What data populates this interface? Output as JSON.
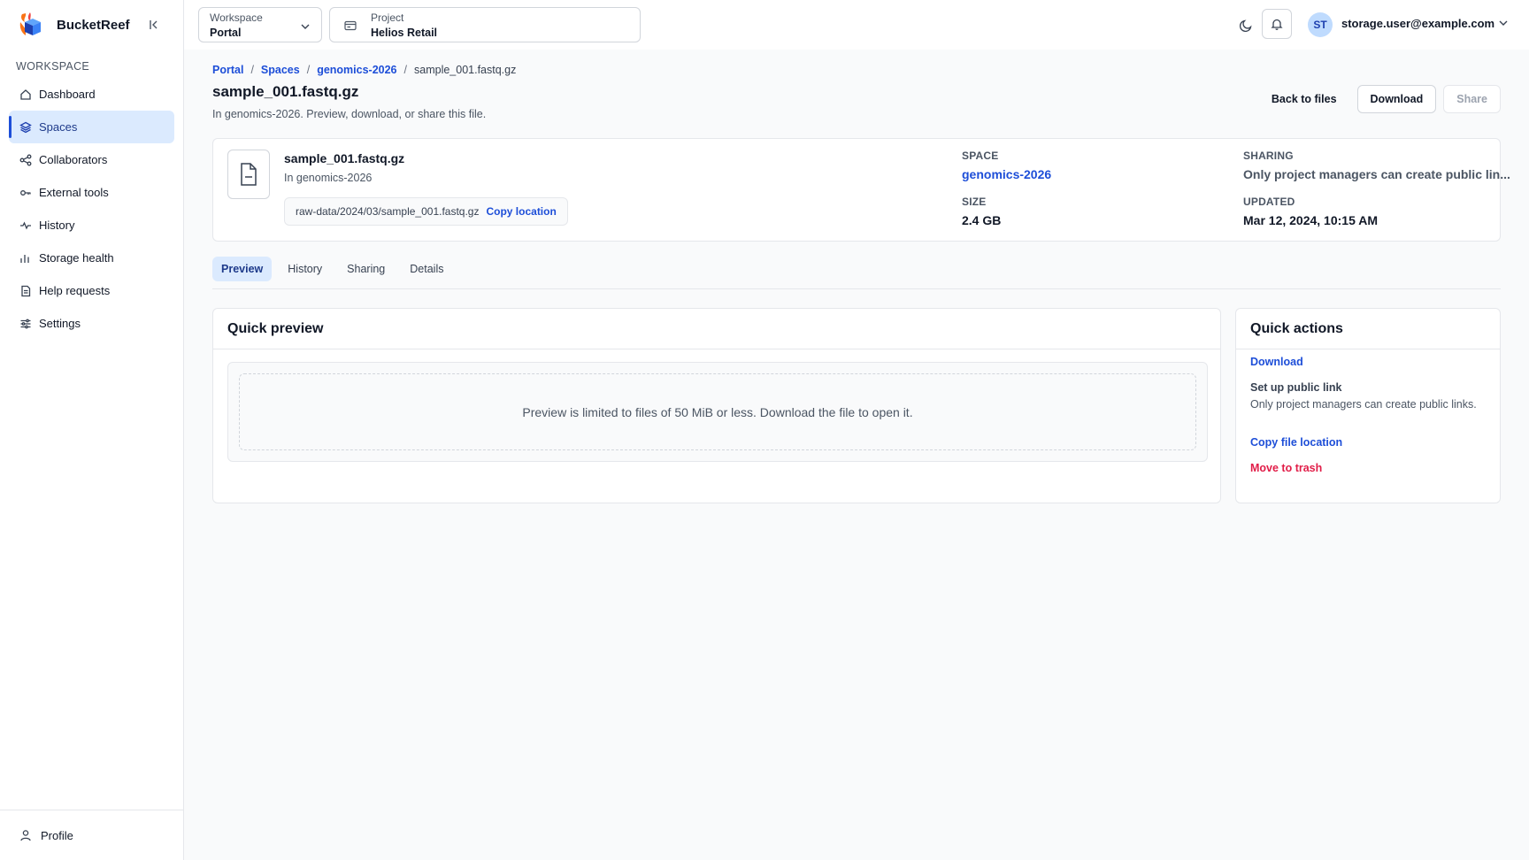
{
  "app": {
    "name": "BucketReef"
  },
  "sidebar": {
    "section_label": "WORKSPACE",
    "items": [
      {
        "label": "Dashboard",
        "icon": "home-icon"
      },
      {
        "label": "Spaces",
        "icon": "layers-icon",
        "active": true
      },
      {
        "label": "Collaborators",
        "icon": "share-nodes-icon"
      },
      {
        "label": "External tools",
        "icon": "key-icon"
      },
      {
        "label": "History",
        "icon": "activity-icon"
      },
      {
        "label": "Storage health",
        "icon": "bar-chart-icon"
      },
      {
        "label": "Help requests",
        "icon": "document-icon"
      },
      {
        "label": "Settings",
        "icon": "sliders-icon"
      }
    ],
    "footer": {
      "label": "Profile",
      "icon": "user-icon"
    }
  },
  "topbar": {
    "workspace": {
      "label": "Workspace",
      "value": "Portal"
    },
    "project": {
      "label": "Project",
      "value": "Helios Retail"
    },
    "user": {
      "initials": "ST",
      "email": "storage.user@example.com"
    }
  },
  "breadcrumb": {
    "items": [
      "Portal",
      "Spaces",
      "genomics-2026"
    ],
    "current": "sample_001.fastq.gz"
  },
  "page": {
    "title": "sample_001.fastq.gz",
    "subtitle": "In genomics-2026. Preview, download, or share this file.",
    "actions": {
      "back": "Back to files",
      "download": "Download",
      "share": "Share"
    }
  },
  "file": {
    "name": "sample_001.fastq.gz",
    "location_line": "In genomics-2026",
    "path": "raw-data/2024/03/sample_001.fastq.gz",
    "copy_label": "Copy location",
    "space_label": "SPACE",
    "space_value": "genomics-2026",
    "size_label": "SIZE",
    "size_value": "2.4 GB",
    "sharing_label": "SHARING",
    "sharing_value": "Only project managers can create public lin...",
    "updated_label": "UPDATED",
    "updated_value": "Mar 12, 2024, 10:15 AM"
  },
  "tabs": [
    "Preview",
    "History",
    "Sharing",
    "Details"
  ],
  "preview": {
    "title": "Quick preview",
    "message": "Preview is limited to files of 50 MiB or less. Download the file to open it."
  },
  "quick_actions": {
    "title": "Quick actions",
    "download": "Download",
    "public_link_title": "Set up public link",
    "public_link_desc": "Only project managers can create public links.",
    "copy_location": "Copy file location",
    "trash": "Move to trash"
  },
  "colors": {
    "accent": "#1d4ed8",
    "active_bg": "#dbeafe",
    "danger": "#e11d48"
  }
}
